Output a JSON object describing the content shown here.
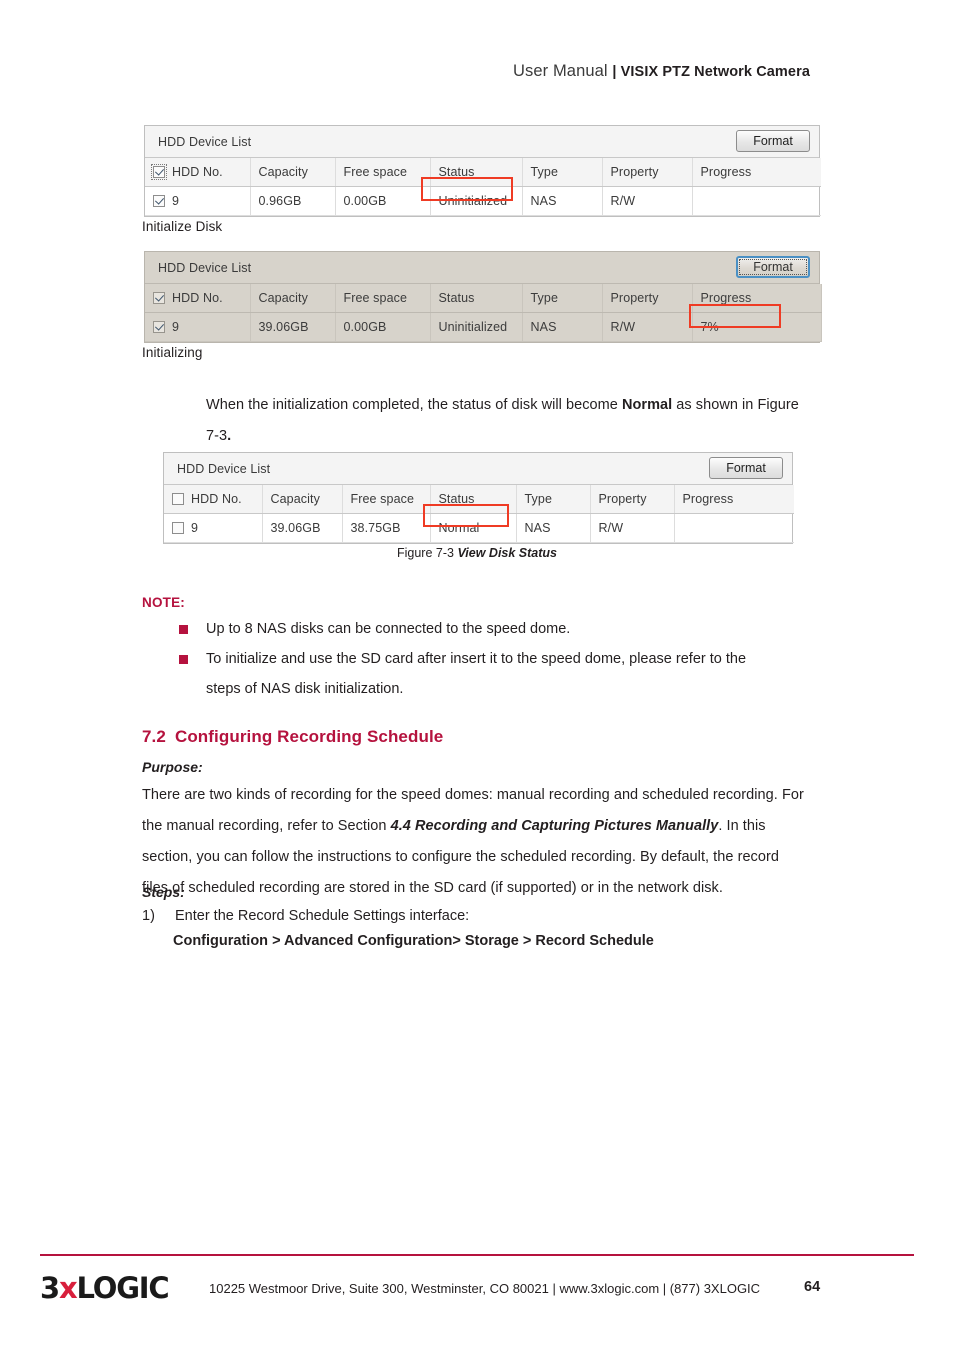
{
  "header": {
    "title_light": "User Manual ",
    "separator_bold": "| VISIX PTZ Network Camera"
  },
  "tables": [
    {
      "panel_title": "HDD Device List",
      "format_label": "Format",
      "columns": [
        "HDD No.",
        "Capacity",
        "Free space",
        "Status",
        "Type",
        "Property",
        "Progress"
      ],
      "row": {
        "hdd_no": "9",
        "capacity": "0.96GB",
        "free_space": "0.00GB",
        "status": "Uninitialized",
        "type": "NAS",
        "property": "R/W",
        "progress": ""
      },
      "checked": true,
      "state": "normal",
      "highlight": "status"
    },
    {
      "panel_title": "HDD Device List",
      "format_label": "Format",
      "columns": [
        "HDD No.",
        "Capacity",
        "Free space",
        "Status",
        "Type",
        "Property",
        "Progress"
      ],
      "row": {
        "hdd_no": "9",
        "capacity": "39.06GB",
        "free_space": "0.00GB",
        "status": "Uninitialized",
        "type": "NAS",
        "property": "R/W",
        "progress": "7%"
      },
      "checked": true,
      "state": "gray",
      "highlight": "progress"
    },
    {
      "panel_title": "HDD Device List",
      "format_label": "Format",
      "columns": [
        "HDD No.",
        "Capacity",
        "Free space",
        "Status",
        "Type",
        "Property",
        "Progress"
      ],
      "row": {
        "hdd_no": "9",
        "capacity": "39.06GB",
        "free_space": "38.75GB",
        "status": "Normal",
        "type": "NAS",
        "property": "R/W",
        "progress": ""
      },
      "checked": false,
      "state": "normal",
      "highlight": "status"
    }
  ],
  "captions": {
    "initialize_disk": "Initialize Disk",
    "initializing": "Initializing",
    "figure_number": "Figure 7-3 ",
    "figure_title": "View Disk Status"
  },
  "body": {
    "init_complete_part1": "When the initialization completed, the status of disk will become ",
    "init_complete_bold": "Normal",
    "init_complete_part2": " as shown in Figure",
    "init_complete_line2": "7-3",
    "init_complete_line2_period": "."
  },
  "note": {
    "label": "NOTE:",
    "items": [
      "Up to 8 NAS disks can be connected to the speed dome.",
      "To initialize and use the SD card after insert it to the speed dome, please refer to the",
      "steps of NAS disk initialization."
    ]
  },
  "section": {
    "number": "7.2",
    "title": "Configuring Recording Schedule",
    "purpose_label": "Purpose:",
    "purpose_line1": "There are two kinds of recording for the speed domes: manual recording and scheduled recording. For",
    "purpose_line2_pre": "the manual recording, refer to Section ",
    "purpose_line2_bold": "4.4 Recording and Capturing Pictures Manually",
    "purpose_line2_post": ". In this",
    "purpose_line3": "section, you can follow the instructions to configure the scheduled recording. By default, the record",
    "purpose_line4": "files of scheduled recording are stored in the SD card (if supported) or in the network disk.",
    "steps_label": "Steps:",
    "step1_number": "1)",
    "step1_text": "Enter the Record Schedule Settings interface:",
    "step1_path": "Configuration > Advanced Configuration> Storage > Record Schedule"
  },
  "footer": {
    "logo_3": "3",
    "logo_x": "x",
    "logo_logic": "LOGIC",
    "address": "10225 Westmoor Drive, Suite 300, Westminster, CO 80021 | www.3xlogic.com | (877) 3XLOGIC",
    "page_number": "64"
  },
  "colors": {
    "brand_red": "#b5123e",
    "logo_x_red": "#d81f3c",
    "highlight_red": "#ef3b24",
    "focus_blue": "#4a90c4"
  }
}
